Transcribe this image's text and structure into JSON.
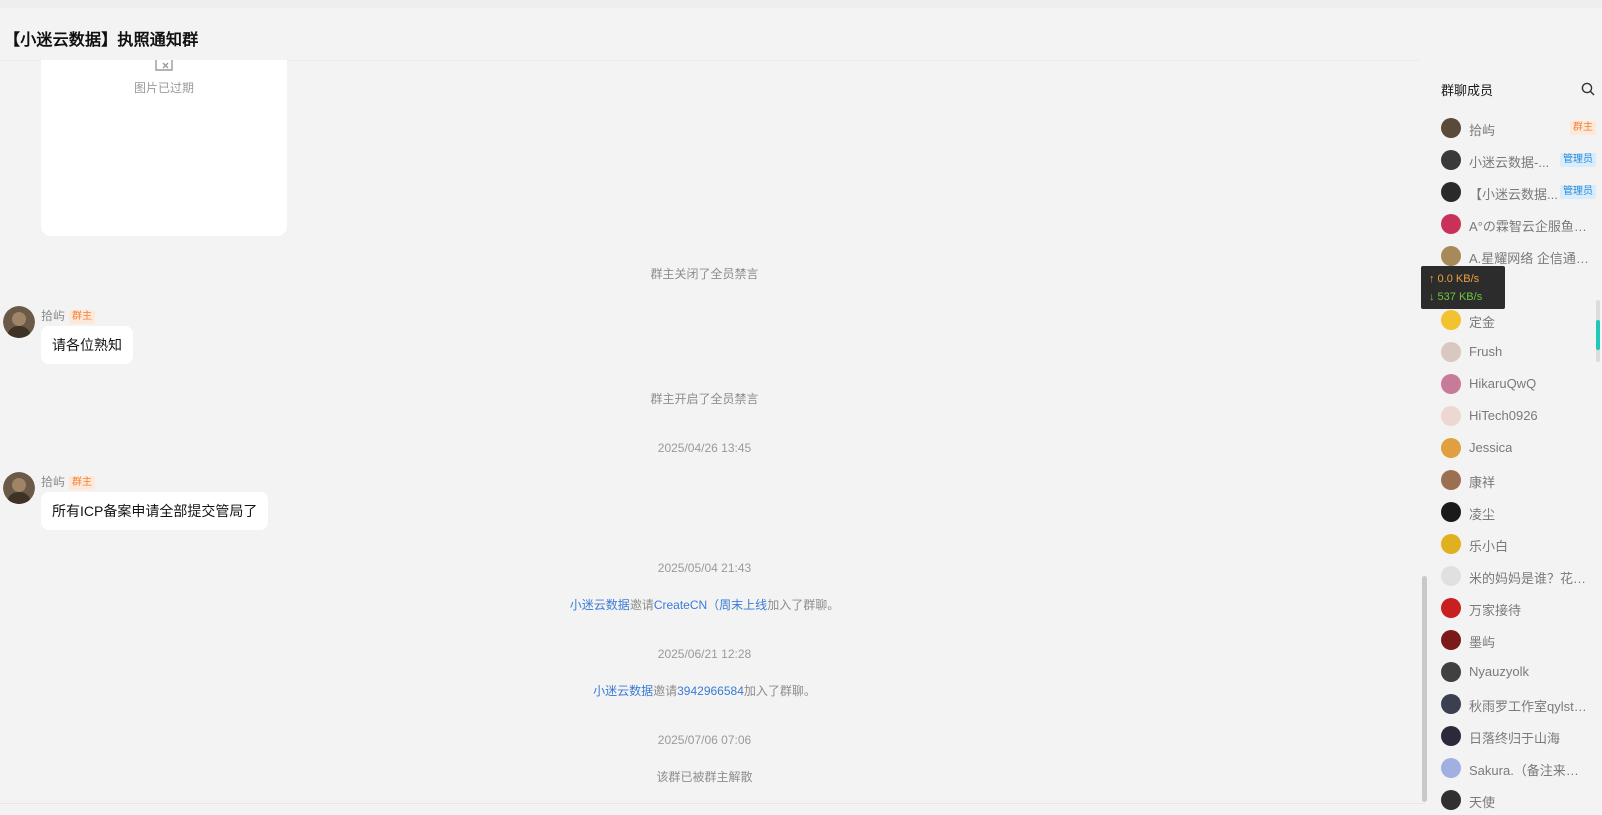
{
  "window": {
    "title": "【小迷云数据】执照通知群"
  },
  "chat": {
    "expired_image_text": "图片已过期",
    "events": [
      {
        "text": "群主关闭了全员禁言"
      },
      {
        "text": "群主开启了全员禁言"
      },
      {
        "text": "2025/04/26 13:45"
      },
      {
        "text": "2025/05/04 21:43"
      },
      {
        "text": "2025/06/21 12:28"
      },
      {
        "text": "2025/07/06 07:06"
      },
      {
        "text": "该群已被群主解散"
      }
    ],
    "invites": [
      {
        "inviter": "小迷云数据",
        "verb": "邀请",
        "invitee": "CreateCN（周末上线",
        "suffix": "加入了群聊。"
      },
      {
        "inviter": "小迷云数据",
        "verb": "邀请",
        "invitee": "3942966584",
        "suffix": "加入了群聊。"
      }
    ],
    "messages": [
      {
        "sender": "拾屿",
        "role": "群主",
        "text": "请各位熟知"
      },
      {
        "sender": "拾屿",
        "role": "群主",
        "text": "所有ICP备案申请全部提交管局了"
      }
    ]
  },
  "members_panel": {
    "title": "群聊成员",
    "members": [
      {
        "name": "拾屿",
        "role": "群主",
        "role_type": "owner",
        "avatar_color": "#5a4a3a"
      },
      {
        "name": "小迷云数据-...",
        "role": "管理员",
        "role_type": "admin",
        "avatar_color": "#3a3a3a"
      },
      {
        "name": "【小迷云数据...",
        "role": "管理员",
        "role_type": "admin",
        "avatar_color": "#2a2a2a"
      },
      {
        "name": "A°の霖智云企服鱼鱼...",
        "role": "",
        "role_type": "",
        "avatar_color": "#c8325a"
      },
      {
        "name": "A.星耀网络 企信通系...",
        "role": "",
        "role_type": "",
        "avatar_color": "#a88a5a"
      },
      {
        "name": "定金",
        "role": "",
        "role_type": "",
        "avatar_color": "#f2c230"
      },
      {
        "name": "Frush",
        "role": "",
        "role_type": "",
        "avatar_color": "#d8c8c0"
      },
      {
        "name": "HikaruQwQ",
        "role": "",
        "role_type": "",
        "avatar_color": "#c87a9a"
      },
      {
        "name": "HiTech0926",
        "role": "",
        "role_type": "",
        "avatar_color": "#ecd8d0"
      },
      {
        "name": "Jessica",
        "role": "",
        "role_type": "",
        "avatar_color": "#e0a040"
      },
      {
        "name": "康祥",
        "role": "",
        "role_type": "",
        "avatar_color": "#9a7050"
      },
      {
        "name": "凌尘",
        "role": "",
        "role_type": "",
        "avatar_color": "#1a1a1a"
      },
      {
        "name": "乐小白",
        "role": "",
        "role_type": "",
        "avatar_color": "#e0b020"
      },
      {
        "name": "米的妈妈是谁？花（...",
        "role": "",
        "role_type": "",
        "avatar_color": "#e0e0e0"
      },
      {
        "name": "万家接待",
        "role": "",
        "role_type": "",
        "avatar_color": "#c82020"
      },
      {
        "name": "墨屿",
        "role": "",
        "role_type": "",
        "avatar_color": "#7a1a1a"
      },
      {
        "name": "Nyauzyolk",
        "role": "",
        "role_type": "",
        "avatar_color": "#404040"
      },
      {
        "name": "秋雨罗工作室qylstu...",
        "role": "",
        "role_type": "",
        "avatar_color": "#3a4050"
      },
      {
        "name": "日落终归于山海",
        "role": "",
        "role_type": "",
        "avatar_color": "#2a2a3a"
      },
      {
        "name": "Sakura.（备注来意谢...",
        "role": "",
        "role_type": "",
        "avatar_color": "#a0b0e0"
      },
      {
        "name": "天使",
        "role": "",
        "role_type": "",
        "avatar_color": "#303030"
      }
    ]
  },
  "netspeed": {
    "up": "↑ 0.0 KB/s",
    "down": "↓ 537 KB/s"
  },
  "colors": {
    "link": "#3a7bd5",
    "owner_tag": "#f2823a",
    "admin_tag": "#2a8ad8",
    "scroll_accent": "#1fc8b8"
  }
}
